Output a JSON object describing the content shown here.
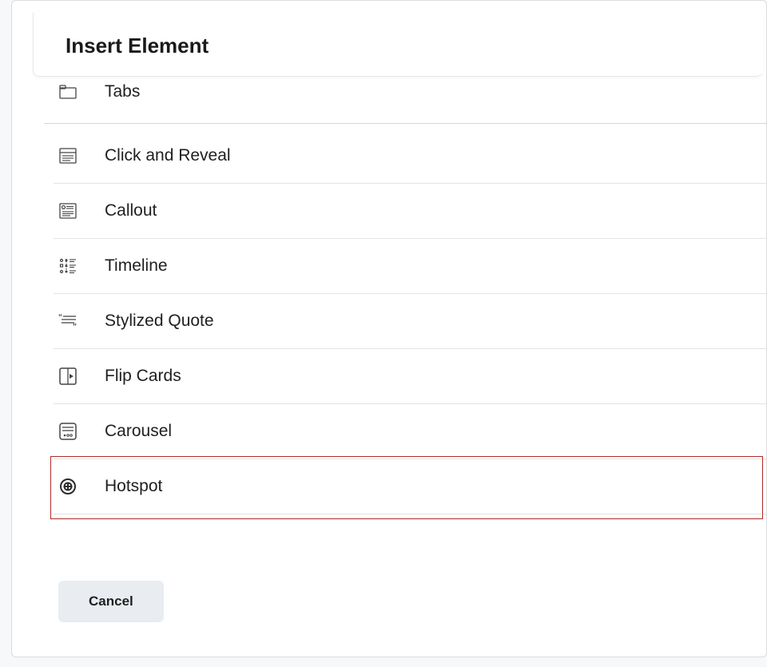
{
  "header": {
    "title": "Insert Element"
  },
  "partial_item": {
    "label": "Tabs"
  },
  "items": [
    {
      "label": "Click and Reveal",
      "icon": "click-reveal-icon"
    },
    {
      "label": "Callout",
      "icon": "callout-icon"
    },
    {
      "label": "Timeline",
      "icon": "timeline-icon"
    },
    {
      "label": "Stylized Quote",
      "icon": "quote-icon"
    },
    {
      "label": "Flip Cards",
      "icon": "flip-cards-icon"
    },
    {
      "label": "Carousel",
      "icon": "carousel-icon"
    },
    {
      "label": "Hotspot",
      "icon": "hotspot-icon",
      "highlighted": true
    }
  ],
  "footer": {
    "cancel_label": "Cancel"
  }
}
